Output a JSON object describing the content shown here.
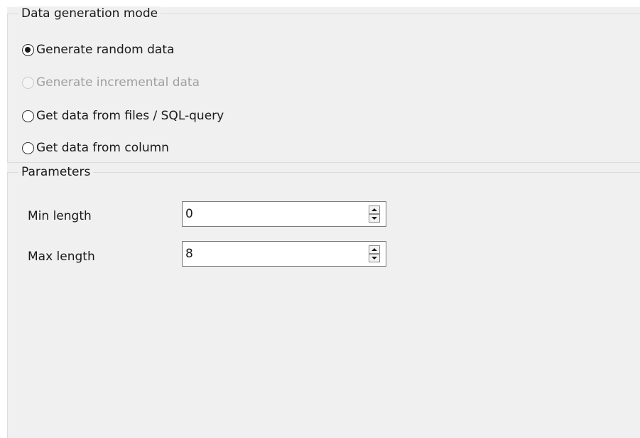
{
  "mode_group": {
    "title": "Data generation mode",
    "options": [
      {
        "label": "Generate random data",
        "checked": true,
        "enabled": true
      },
      {
        "label": "Generate incremental data",
        "checked": false,
        "enabled": false
      },
      {
        "label": "Get data from files / SQL-query",
        "checked": false,
        "enabled": true
      },
      {
        "label": "Get data from column",
        "checked": false,
        "enabled": true
      }
    ]
  },
  "params_group": {
    "title": "Parameters",
    "min_length": {
      "label": "Min length",
      "value": "0"
    },
    "max_length": {
      "label": "Max length",
      "value": "8"
    }
  }
}
